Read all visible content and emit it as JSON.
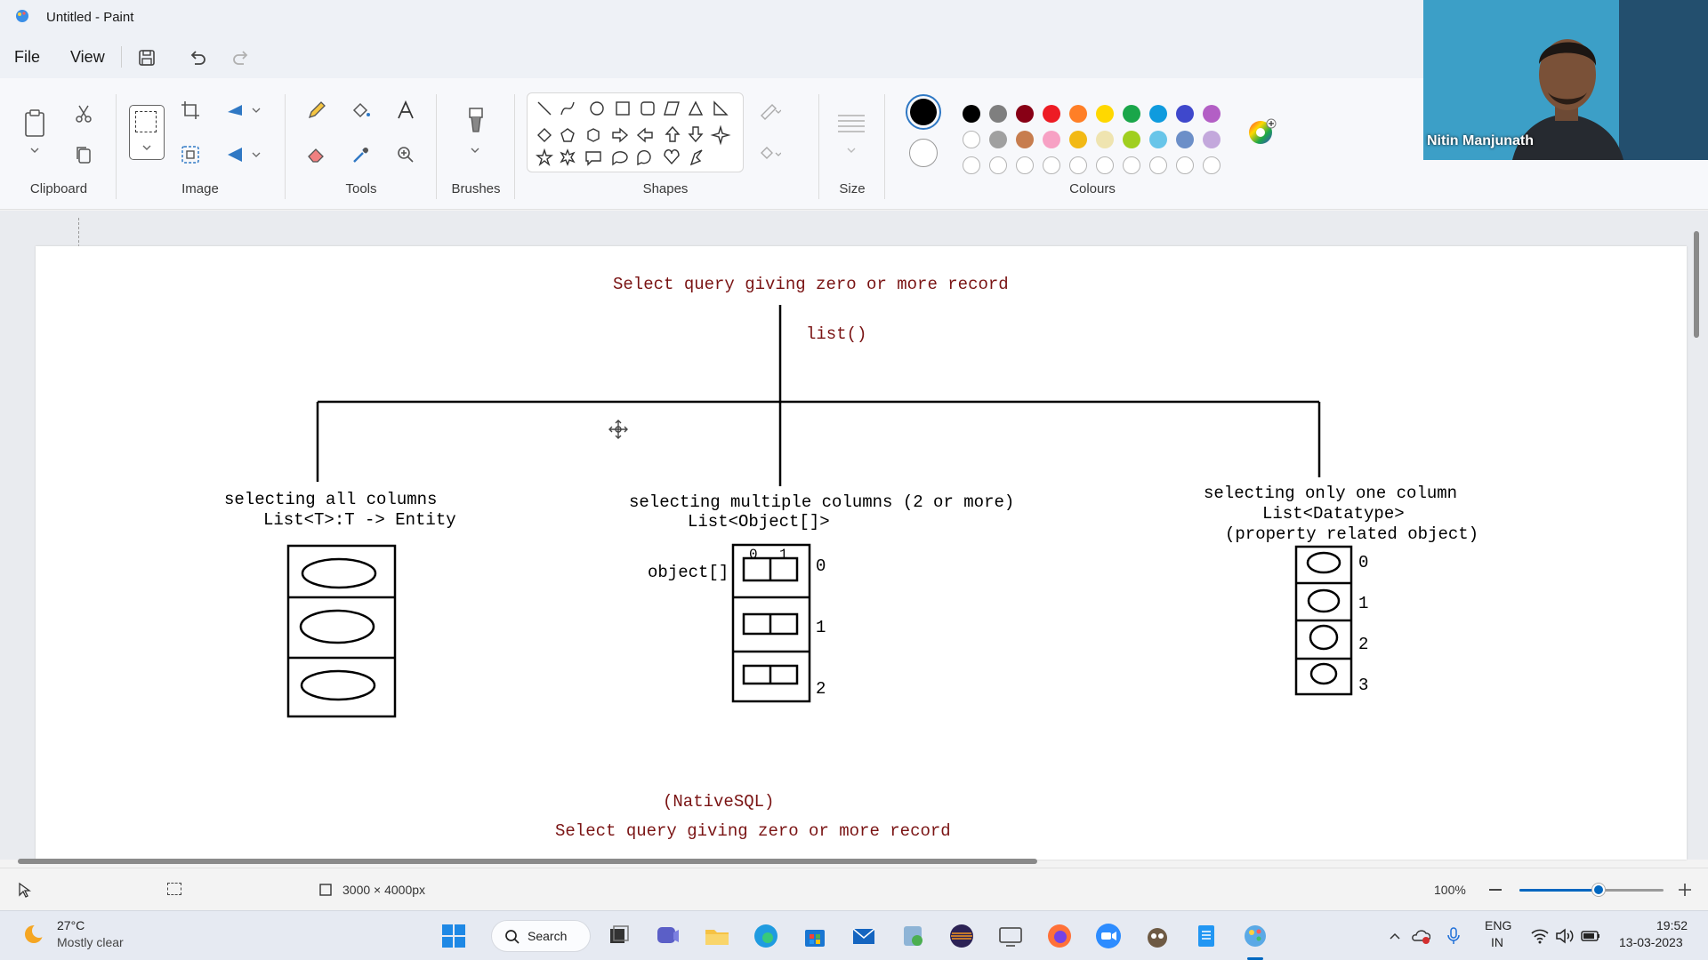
{
  "window": {
    "title": "Untitled - Paint"
  },
  "menu": {
    "file": "File",
    "view": "View"
  },
  "ribbon": {
    "groups": {
      "clipboard": "Clipboard",
      "image": "Image",
      "tools": "Tools",
      "brushes": "Brushes",
      "shapes": "Shapes",
      "size": "Size",
      "colours": "Colours"
    },
    "palette_row1": [
      "#000000",
      "#7f7f7f",
      "#880015",
      "#ed1c24",
      "#ff7f27",
      "#ffd800",
      "#1aa64a",
      "#0f9bde",
      "#3f48cc",
      "#b35fc5"
    ],
    "palette_row2": [
      "",
      "#a0a0a0",
      "#c77d4e",
      "#f7a1c4",
      "#f2b915",
      "#efe4b0",
      "#a0cf1f",
      "#68c5e9",
      "#6c8fc8",
      "#c3a8dc"
    ],
    "primary_colour": "#000000",
    "secondary_colour": "#ffffff"
  },
  "webcam": {
    "name": "Nitin Manjunath"
  },
  "canvas": {
    "heading": "Select query giving zero or more record",
    "method": "list()",
    "branches": {
      "left": {
        "title": "selecting all columns",
        "type": "List<T>:T -> Entity"
      },
      "middle": {
        "title": "selecting multiple columns (2 or more)",
        "type": "List<Object[]>",
        "array_label": "object[]",
        "inner_index_0": "0",
        "inner_index_1": "1",
        "row_indices": [
          "0",
          "1",
          "2"
        ]
      },
      "right": {
        "title": "selecting only one column",
        "type": "List<Datatype>",
        "note": "(property related object)",
        "row_indices": [
          "0",
          "1",
          "2",
          "3"
        ]
      }
    },
    "footer_note": "(NativeSQL)",
    "footer_heading": "Select query giving zero or more record"
  },
  "status": {
    "canvas_size": "3000 × 4000px",
    "zoom": "100%",
    "zoom_fraction": 0.55
  },
  "taskbar": {
    "weather_temp": "27°C",
    "weather_desc": "Mostly clear",
    "search": "Search",
    "language": "ENG",
    "region": "IN",
    "time": "19:52",
    "date": "13-03-2023"
  }
}
